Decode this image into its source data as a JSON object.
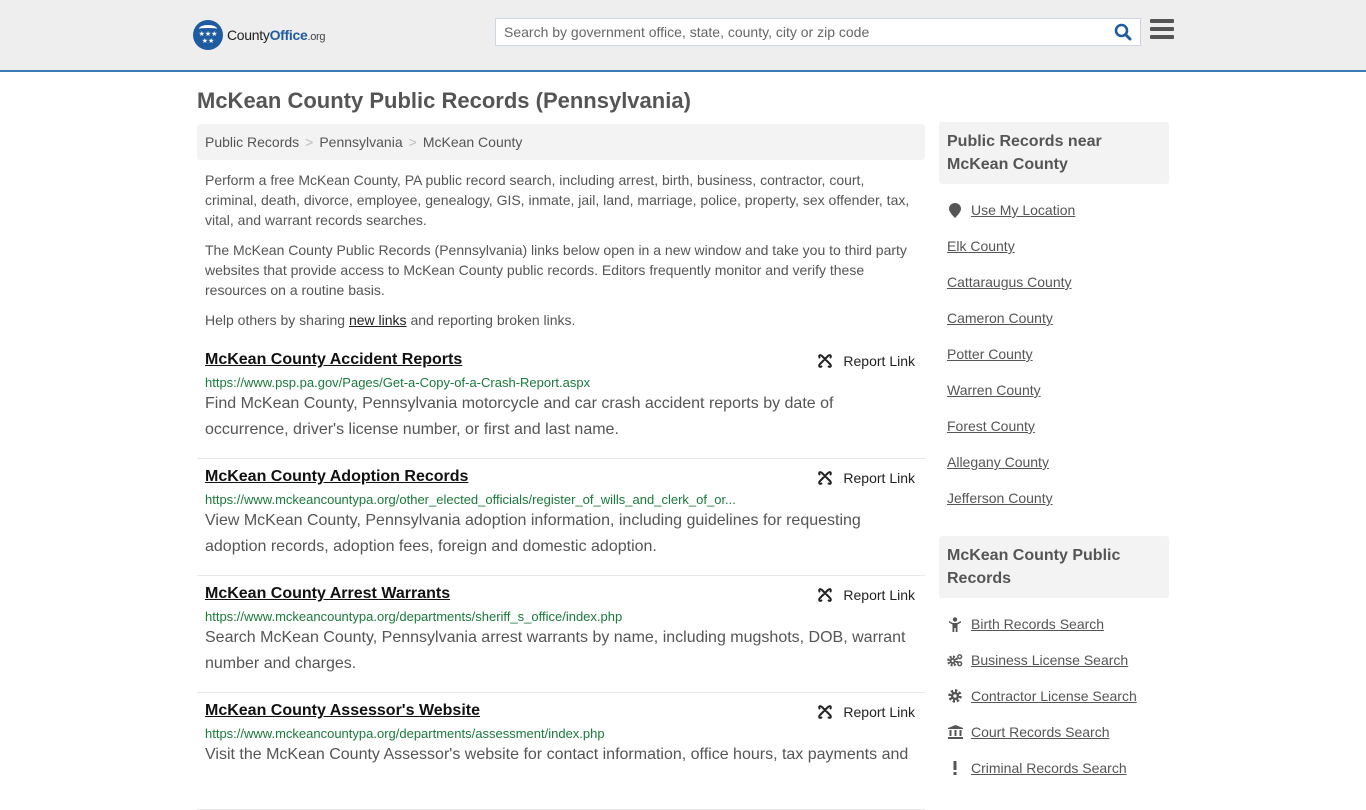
{
  "header": {
    "logo_text_main": "County",
    "logo_text_brand": "Office",
    "logo_text_tld": ".org",
    "search_placeholder": "Search by government office, state, county, city or zip code",
    "search_value": ""
  },
  "page": {
    "title": "McKean County Public Records (Pennsylvania)"
  },
  "breadcrumb": [
    {
      "label": "Public Records"
    },
    {
      "label": "Pennsylvania"
    },
    {
      "label": "McKean County"
    }
  ],
  "breadcrumb_separator": ">",
  "intro": {
    "p1": "Perform a free McKean County, PA public record search, including arrest, birth, business, contractor, court, criminal, death, divorce, employee, genealogy, GIS, inmate, jail, land, marriage, police, property, sex offender, tax, vital, and warrant records searches.",
    "p2": "The McKean County Public Records (Pennsylvania) links below open in a new window and take you to third party websites that provide access to McKean County public records. Editors frequently monitor and verify these resources on a routine basis.",
    "p3_before": "Help others by sharing ",
    "p3_link": "new links",
    "p3_after": " and reporting broken links."
  },
  "report_label": "Report Link",
  "records": [
    {
      "title": "McKean County Accident Reports",
      "url": "https://www.psp.pa.gov/Pages/Get-a-Copy-of-a-Crash-Report.aspx",
      "description": "Find McKean County, Pennsylvania motorcycle and car crash accident reports by date of occurrence, driver's license number, or first and last name."
    },
    {
      "title": "McKean County Adoption Records",
      "url": "https://www.mckeancountypa.org/other_elected_officials/register_of_wills_and_clerk_of_or...",
      "description": "View McKean County, Pennsylvania adoption information, including guidelines for requesting adoption records, adoption fees, foreign and domestic adoption."
    },
    {
      "title": "McKean County Arrest Warrants",
      "url": "https://www.mckeancountypa.org/departments/sheriff_s_office/index.php",
      "description": "Search McKean County, Pennsylvania arrest warrants by name, including mugshots, DOB, warrant number and charges."
    },
    {
      "title": "McKean County Assessor's Website",
      "url": "https://www.mckeancountypa.org/departments/assessment/index.php",
      "description": "Visit the McKean County Assessor's website for contact information, office hours, tax payments and"
    }
  ],
  "sidebar": {
    "nearby_heading": "Public Records near McKean County",
    "use_location": "Use My Location",
    "nearby": [
      "Elk County",
      "Cattaraugus County",
      "Cameron County",
      "Potter County",
      "Warren County",
      "Forest County",
      "Allegany County",
      "Jefferson County"
    ],
    "records_heading": "McKean County Public Records",
    "record_links": [
      {
        "label": "Birth Records Search",
        "icon": "child-icon"
      },
      {
        "label": "Business License Search",
        "icon": "gears-icon"
      },
      {
        "label": "Contractor License Search",
        "icon": "gear-icon"
      },
      {
        "label": "Court Records Search",
        "icon": "courthouse-icon"
      },
      {
        "label": "Criminal Records Search",
        "icon": "exclamation-icon"
      }
    ]
  },
  "colors": {
    "accent": "#3a7cb8",
    "brand": "#1f5ba0",
    "url_green": "#1a7a3a"
  }
}
